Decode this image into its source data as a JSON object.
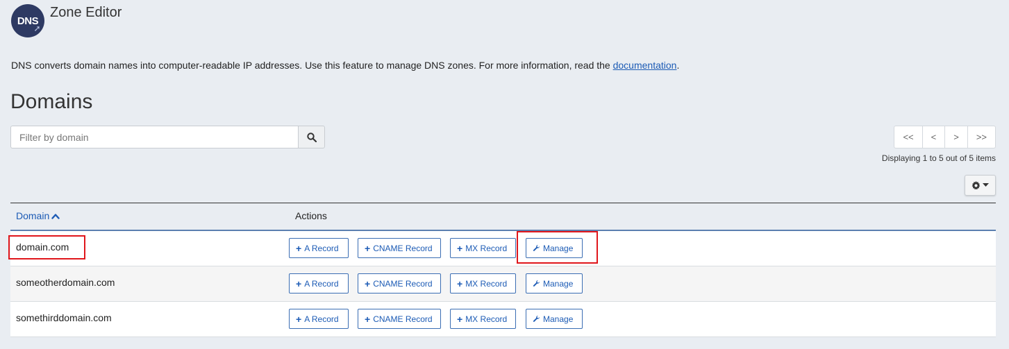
{
  "header": {
    "logo_text": "DNS",
    "title": "Zone Editor"
  },
  "intro": {
    "text": "DNS converts domain names into computer-readable IP addresses. Use this feature to manage DNS zones. For more information, read the ",
    "link": "documentation",
    "suffix": "."
  },
  "section": {
    "title": "Domains"
  },
  "filter": {
    "placeholder": "Filter by domain",
    "value": ""
  },
  "pagination": {
    "first": "<<",
    "prev": "<",
    "next": ">",
    "last": ">>",
    "info": "Displaying 1 to 5 out of 5 items"
  },
  "table": {
    "col_domain": "Domain",
    "col_actions": "Actions",
    "rows": [
      {
        "domain": "domain.com"
      },
      {
        "domain": "someotherdomain.com"
      },
      {
        "domain": "somethirddomain.com"
      }
    ],
    "actions": {
      "a_record": "A Record",
      "cname_record": "CNAME Record",
      "mx_record": "MX Record",
      "manage": "Manage"
    }
  },
  "colors": {
    "link": "#1c5bb5",
    "highlight": "#e0161b",
    "logo_bg": "#2e3a63"
  },
  "icons": [
    "search-icon",
    "gear-icon",
    "caret-down-icon",
    "chevron-up-icon",
    "plus-icon",
    "wrench-icon"
  ]
}
